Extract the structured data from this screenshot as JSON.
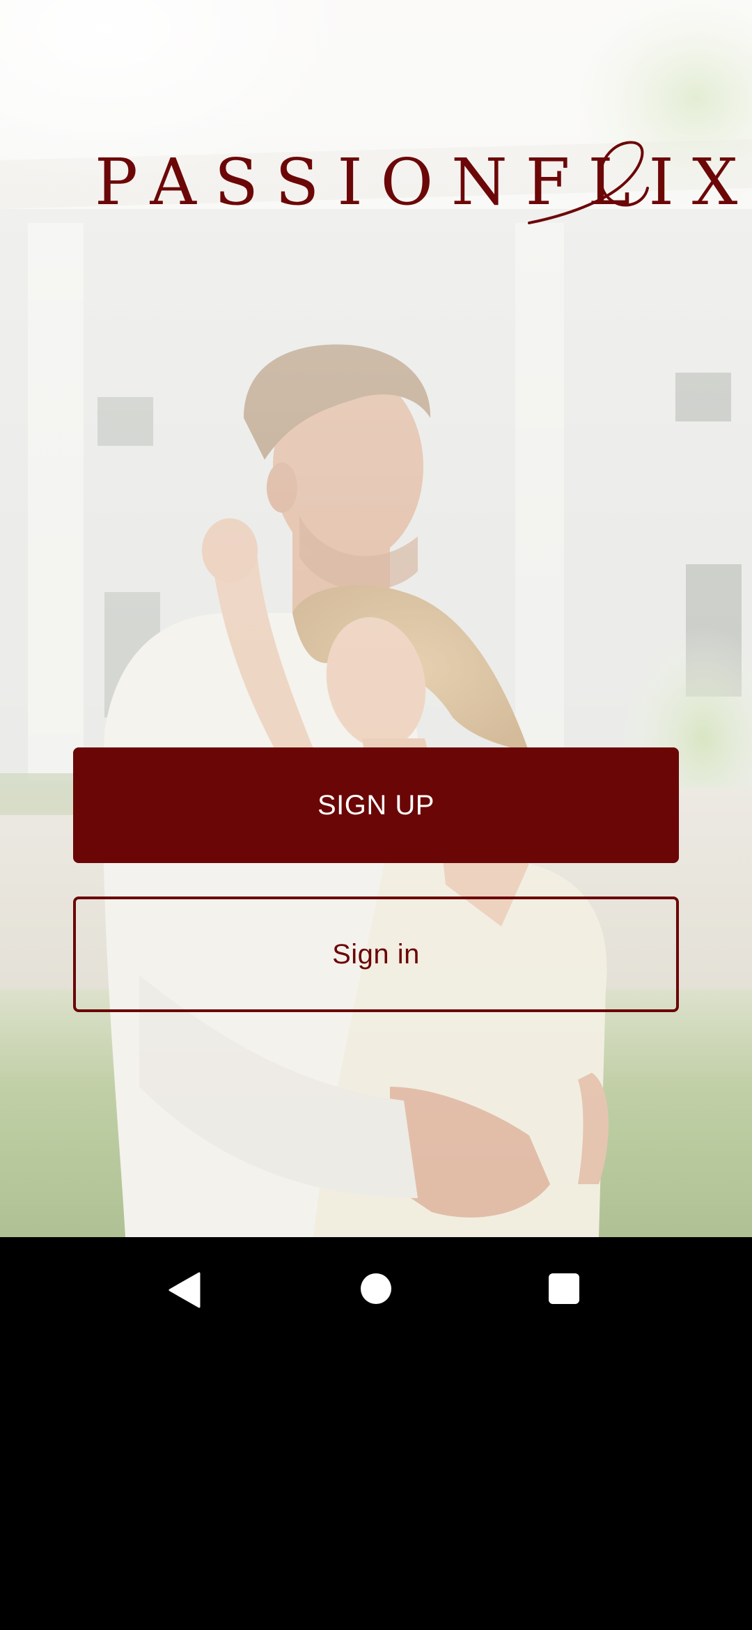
{
  "app": {
    "logo_text": "PASSIONFLIX"
  },
  "buttons": {
    "sign_up_label": "SIGN UP",
    "sign_in_label": "Sign in"
  },
  "colors": {
    "brand": "#6b0606",
    "button_text_on_brand": "#ffffff",
    "navbar_background": "#000000"
  },
  "background": {
    "icon": "couple-embrace-photo"
  },
  "navbar": {
    "back_icon": "back-triangle-icon",
    "home_icon": "home-circle-icon",
    "recents_icon": "recents-square-icon"
  }
}
